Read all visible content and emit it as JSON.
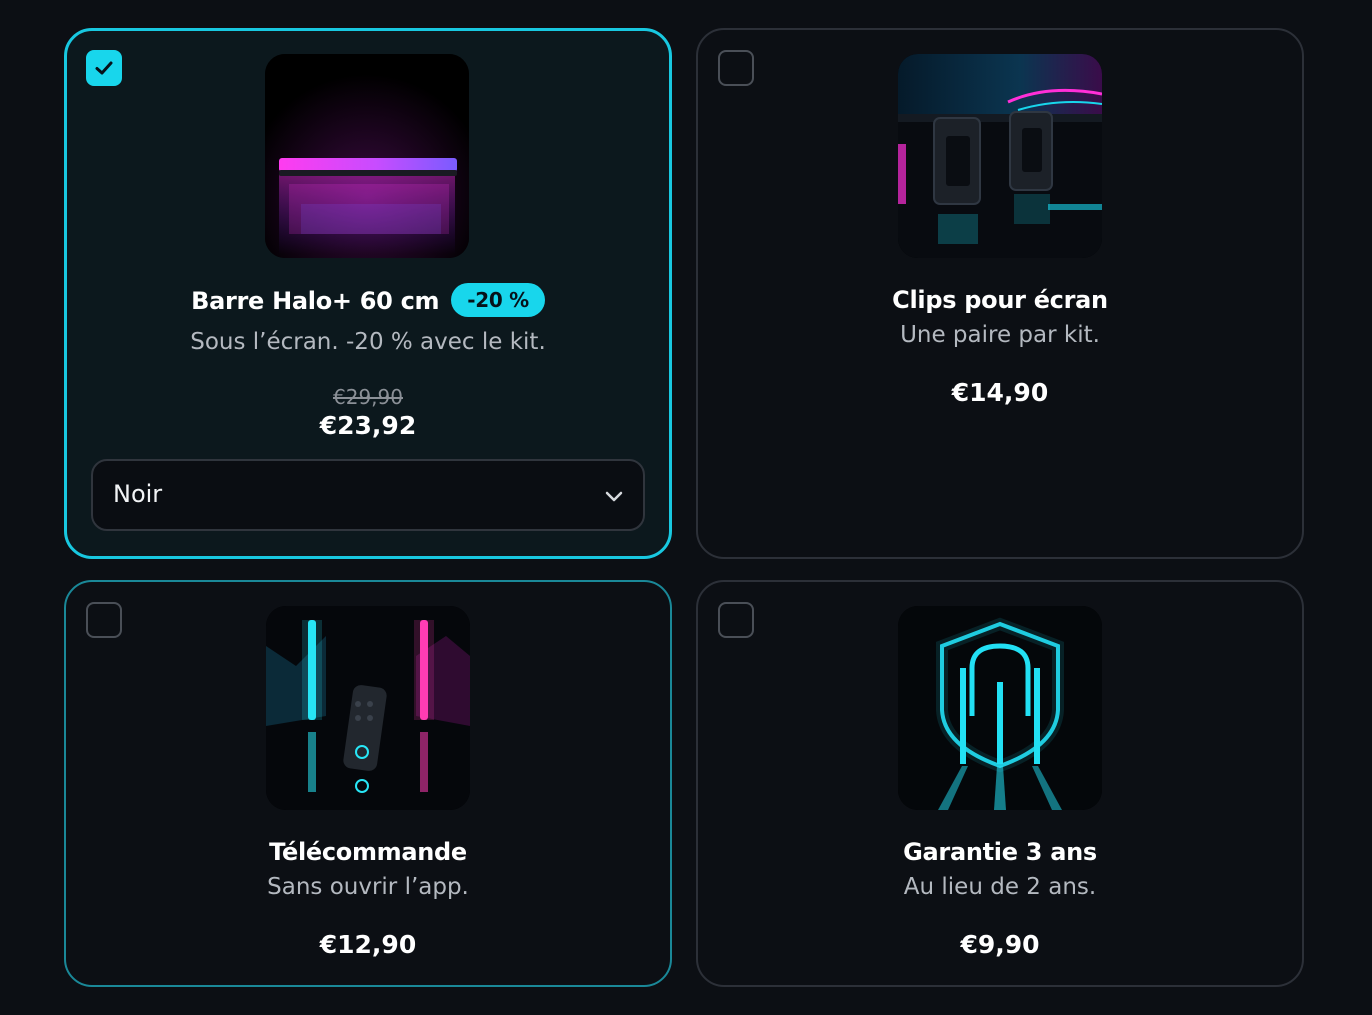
{
  "colors": {
    "accent": "#18d6ec",
    "background": "#0c0f14",
    "selected_card_bg": "#0c181d",
    "muted_text": "#b4b9c0"
  },
  "products": [
    {
      "title": "Barre Halo+ 60 cm",
      "badge": "-20 %",
      "subtitle": "Sous l’écran. -20 % avec le kit.",
      "old_price": "€29,90",
      "price": "€23,92",
      "checked": true,
      "variant_select": {
        "value": "Noir",
        "icon": "chevron-down-icon"
      }
    },
    {
      "title": "Clips pour écran",
      "subtitle": "Une paire par kit.",
      "price": "€14,90",
      "checked": false
    },
    {
      "title": "Télécommande",
      "subtitle": "Sans ouvrir l’app.",
      "price": "€12,90",
      "checked": false
    },
    {
      "title": "Garantie 3 ans",
      "subtitle": "Au lieu de 2 ans.",
      "price": "€9,90",
      "checked": false
    }
  ]
}
